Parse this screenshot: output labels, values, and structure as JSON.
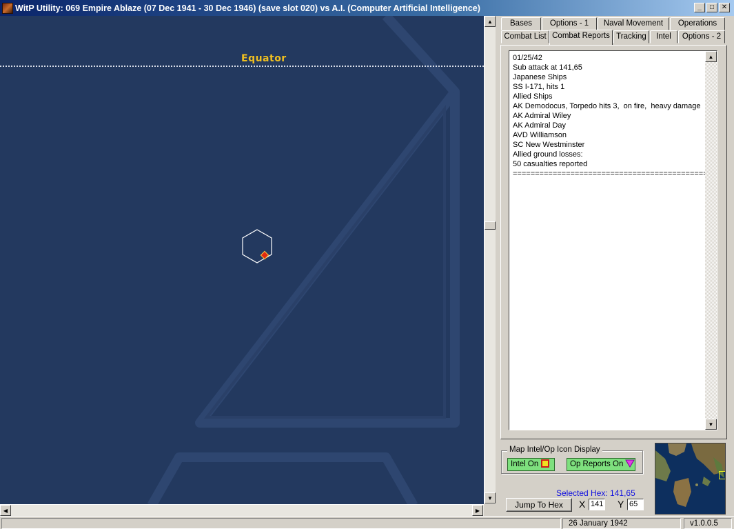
{
  "window": {
    "title": "WitP Utility:  069 Empire Ablaze (07 Dec 1941 - 30 Dec 1946) (save slot 020)  vs A.I. (Computer Artificial Intelligence)",
    "minimize": "_",
    "maximize": "□",
    "close": "✕"
  },
  "map": {
    "equator_label": "Equator"
  },
  "tabs": {
    "row1": [
      "Bases",
      "Options - 1",
      "Naval Movement",
      "Operations"
    ],
    "row2": [
      "Combat List",
      "Combat Reports",
      "Tracking",
      "Intel",
      "Options - 2"
    ],
    "active": "Combat Reports"
  },
  "combat_report": {
    "lines": [
      "01/25/42",
      "Sub attack at 141,65",
      "Japanese Ships",
      "SS I-171, hits 1",
      "Allied Ships",
      "AK Demodocus, Torpedo hits 3,  on fire,  heavy damage",
      "AK Admiral Wiley",
      "AK Admiral Day",
      "AVD Williamson",
      "SC New Westminster",
      "Allied ground losses:",
      "50 casualties reported",
      "=============================================="
    ]
  },
  "icon_display": {
    "group_label": "Map Intel/Op Icon Display",
    "intel_button": "Intel On",
    "op_reports_button": "Op Reports On"
  },
  "hex_nav": {
    "selected_hex": "Selected Hex: 141,65",
    "jump_button": "Jump To Hex",
    "x_label": "X",
    "x_value": "141",
    "y_label": "Y",
    "y_value": "65"
  },
  "status_bar": {
    "date": "26 January 1942",
    "version": "v1.0.0.5"
  },
  "colors": {
    "map_ocean": "#23395f",
    "equator_label": "#f0c020",
    "selected_hex_text": "#1010e0",
    "toggle_on": "#7ee07e"
  }
}
